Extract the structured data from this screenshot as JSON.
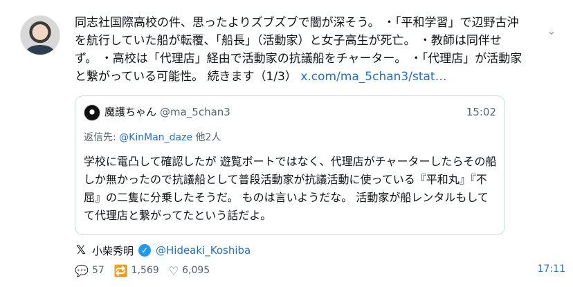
{
  "tweet": {
    "text": "同志社国際高校の件、思ったよりズブズブで闇が深そう。 ・「平和学習」で辺野古沖を航行していた船が転覆、「船長」（活動家）と女子高生が死亡。 ・教師は同伴せず。 ・高校は「代理店」経由で活動家の抗議船をチャーター。 ・「代理店」が活動家と繋がっている可能性。 続きます（1/3）",
    "link": "x.com/ma_5chan3/stat…"
  },
  "quote": {
    "name": "魔護ちゃん",
    "handle": "@ma_5chan3",
    "time": "15:02",
    "reply_prefix": "返信先: ",
    "reply_mention": "@KinMan_daze",
    "reply_suffix": " 他2人",
    "text": "学校に電凸して確認したが 遊覧ボートではなく、代理店がチャーターしたらその船しか無かったので抗議船として普段活動家が抗議活動に使っている『平和丸』『不屈』の二隻に分乗したそうだ。 ものは言いようだな。 活動家が船レンタルもしてて代理店と繋がってたという話だよ。"
  },
  "source": {
    "logo": "𝕏",
    "name": "小柴秀明",
    "verified_mark": "✓",
    "handle": "@Hideaki_Koshiba"
  },
  "stats": {
    "replies": "57",
    "retweets": "1,569",
    "likes": "6,095"
  },
  "icons": {
    "reply": "reply-icon",
    "retweet": "retweet-icon",
    "like": "heart-icon",
    "more": "chevron-down-icon"
  },
  "time": "17:11"
}
